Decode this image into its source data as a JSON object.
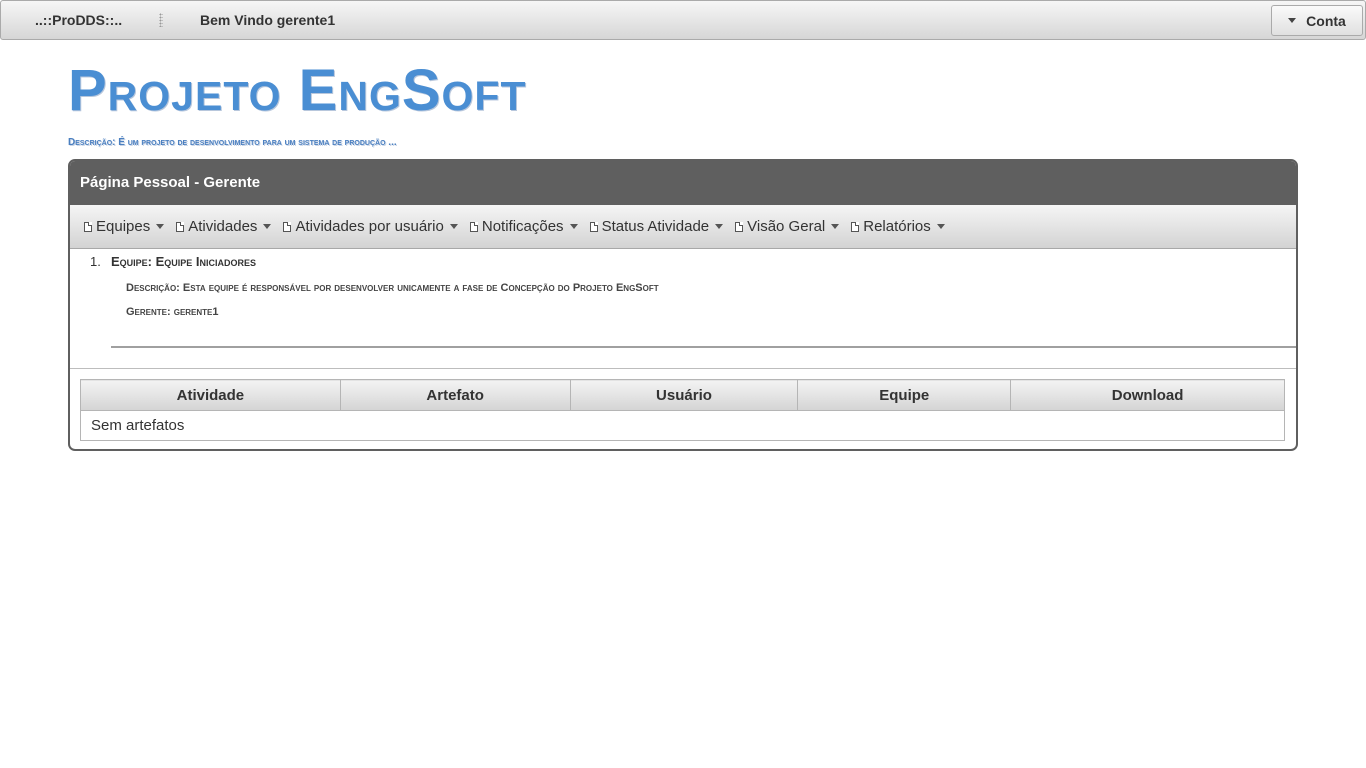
{
  "topbar": {
    "brand": "..::ProDDS::..",
    "welcome": "Bem Vindo gerente1",
    "account_label": "Conta"
  },
  "project": {
    "title": "Projeto EngSoft",
    "description": "Descrição: É um projeto de desenvolvimento para um sistema de produção ..."
  },
  "panel": {
    "header": "Página Pessoal - Gerente",
    "menu": [
      {
        "label": "Equipes",
        "icon": "document-icon"
      },
      {
        "label": "Atividades",
        "icon": "document-icon"
      },
      {
        "label": "Atividades por usuário",
        "icon": "document-icon"
      },
      {
        "label": "Notificações",
        "icon": "document-icon"
      },
      {
        "label": "Status Atividade",
        "icon": "document-icon"
      },
      {
        "label": "Visão Geral",
        "icon": "document-icon"
      },
      {
        "label": "Relatórios",
        "icon": "document-icon"
      }
    ],
    "team": {
      "number": "1.",
      "name": "Equipe: Equipe Iniciadores",
      "description": "Descrição: Esta equipe é responsável por desenvolver unicamente a fase de Concepção do Projeto EngSoft",
      "manager": "Gerente: gerente1"
    },
    "table": {
      "headers": [
        "Atividade",
        "Artefato",
        "Usuário",
        "Equipe",
        "Download"
      ],
      "empty_message": "Sem artefatos"
    }
  },
  "colors": {
    "title_blue": "#4a8ed3",
    "panel_header": "#5f5f5f"
  }
}
